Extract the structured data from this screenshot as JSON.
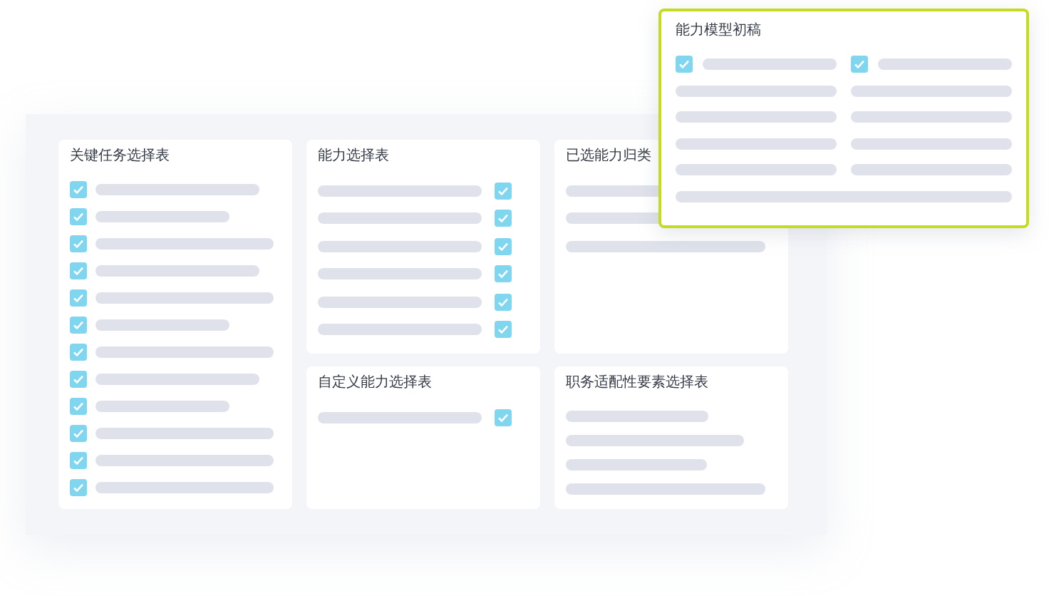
{
  "panels": [
    {
      "title": "关键任务选择表",
      "kind": "check-left",
      "rows": [
        {
          "kind": "check",
          "checked": true
        },
        {
          "kind": "check",
          "checked": true
        },
        {
          "kind": "check",
          "checked": true
        },
        {
          "kind": "check",
          "checked": true
        },
        {
          "kind": "check",
          "checked": true
        },
        {
          "kind": "check",
          "checked": true
        },
        {
          "kind": "check",
          "checked": true
        },
        {
          "kind": "check",
          "checked": true
        },
        {
          "kind": "check",
          "checked": true
        },
        {
          "kind": "check",
          "checked": true
        },
        {
          "kind": "check",
          "checked": true
        },
        {
          "kind": "check",
          "checked": true
        }
      ]
    },
    {
      "title": "能力选择表",
      "kind": "check-right",
      "rows": [
        {
          "kind": "check",
          "checked": true
        },
        {
          "kind": "check",
          "checked": true
        },
        {
          "kind": "check",
          "checked": true
        },
        {
          "kind": "check",
          "checked": true
        },
        {
          "kind": "check",
          "checked": true
        },
        {
          "kind": "check",
          "checked": true
        }
      ]
    },
    {
      "title": "已选能力归类",
      "kind": "plain",
      "rows": [
        {
          "kind": "bar"
        },
        {
          "kind": "bar"
        },
        {
          "kind": "bar"
        }
      ]
    },
    {
      "title": "自定义能力选择表",
      "kind": "check-right",
      "rows": [
        {
          "kind": "check",
          "checked": true
        }
      ]
    },
    {
      "title": "职务适配性要素选择表",
      "kind": "plain",
      "rows": [
        {
          "kind": "bar"
        },
        {
          "kind": "bar"
        },
        {
          "kind": "bar"
        },
        {
          "kind": "bar"
        }
      ]
    }
  ],
  "popup": {
    "title": "能力模型初稿",
    "cells": [
      {
        "kind": "check",
        "checked": true
      },
      {
        "kind": "check",
        "checked": true
      },
      {
        "kind": "bar"
      },
      {
        "kind": "bar"
      },
      {
        "kind": "bar"
      },
      {
        "kind": "bar"
      },
      {
        "kind": "bar"
      },
      {
        "kind": "bar"
      },
      {
        "kind": "bar"
      },
      {
        "kind": "bar"
      },
      {
        "kind": "wide"
      }
    ]
  }
}
